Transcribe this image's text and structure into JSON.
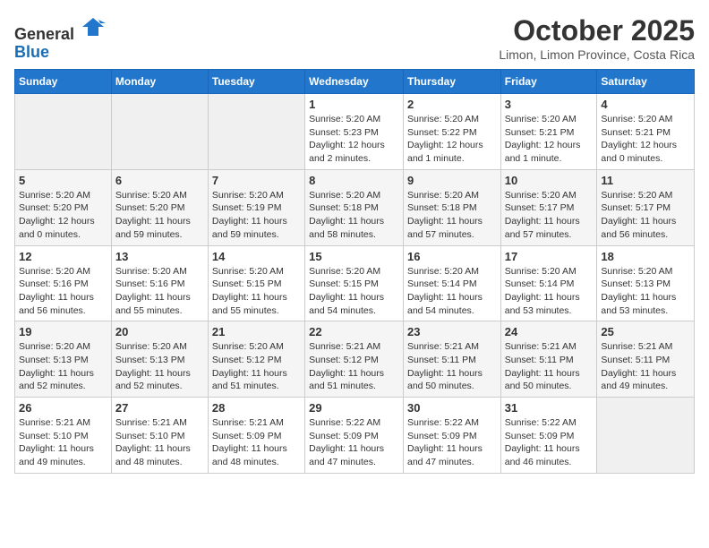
{
  "logo": {
    "general": "General",
    "blue": "Blue"
  },
  "title": "October 2025",
  "location": "Limon, Limon Province, Costa Rica",
  "headers": [
    "Sunday",
    "Monday",
    "Tuesday",
    "Wednesday",
    "Thursday",
    "Friday",
    "Saturday"
  ],
  "weeks": [
    [
      {
        "day": "",
        "info": ""
      },
      {
        "day": "",
        "info": ""
      },
      {
        "day": "",
        "info": ""
      },
      {
        "day": "1",
        "info": "Sunrise: 5:20 AM\nSunset: 5:23 PM\nDaylight: 12 hours and 2 minutes."
      },
      {
        "day": "2",
        "info": "Sunrise: 5:20 AM\nSunset: 5:22 PM\nDaylight: 12 hours and 1 minute."
      },
      {
        "day": "3",
        "info": "Sunrise: 5:20 AM\nSunset: 5:21 PM\nDaylight: 12 hours and 1 minute."
      },
      {
        "day": "4",
        "info": "Sunrise: 5:20 AM\nSunset: 5:21 PM\nDaylight: 12 hours and 0 minutes."
      }
    ],
    [
      {
        "day": "5",
        "info": "Sunrise: 5:20 AM\nSunset: 5:20 PM\nDaylight: 12 hours and 0 minutes."
      },
      {
        "day": "6",
        "info": "Sunrise: 5:20 AM\nSunset: 5:20 PM\nDaylight: 11 hours and 59 minutes."
      },
      {
        "day": "7",
        "info": "Sunrise: 5:20 AM\nSunset: 5:19 PM\nDaylight: 11 hours and 59 minutes."
      },
      {
        "day": "8",
        "info": "Sunrise: 5:20 AM\nSunset: 5:18 PM\nDaylight: 11 hours and 58 minutes."
      },
      {
        "day": "9",
        "info": "Sunrise: 5:20 AM\nSunset: 5:18 PM\nDaylight: 11 hours and 57 minutes."
      },
      {
        "day": "10",
        "info": "Sunrise: 5:20 AM\nSunset: 5:17 PM\nDaylight: 11 hours and 57 minutes."
      },
      {
        "day": "11",
        "info": "Sunrise: 5:20 AM\nSunset: 5:17 PM\nDaylight: 11 hours and 56 minutes."
      }
    ],
    [
      {
        "day": "12",
        "info": "Sunrise: 5:20 AM\nSunset: 5:16 PM\nDaylight: 11 hours and 56 minutes."
      },
      {
        "day": "13",
        "info": "Sunrise: 5:20 AM\nSunset: 5:16 PM\nDaylight: 11 hours and 55 minutes."
      },
      {
        "day": "14",
        "info": "Sunrise: 5:20 AM\nSunset: 5:15 PM\nDaylight: 11 hours and 55 minutes."
      },
      {
        "day": "15",
        "info": "Sunrise: 5:20 AM\nSunset: 5:15 PM\nDaylight: 11 hours and 54 minutes."
      },
      {
        "day": "16",
        "info": "Sunrise: 5:20 AM\nSunset: 5:14 PM\nDaylight: 11 hours and 54 minutes."
      },
      {
        "day": "17",
        "info": "Sunrise: 5:20 AM\nSunset: 5:14 PM\nDaylight: 11 hours and 53 minutes."
      },
      {
        "day": "18",
        "info": "Sunrise: 5:20 AM\nSunset: 5:13 PM\nDaylight: 11 hours and 53 minutes."
      }
    ],
    [
      {
        "day": "19",
        "info": "Sunrise: 5:20 AM\nSunset: 5:13 PM\nDaylight: 11 hours and 52 minutes."
      },
      {
        "day": "20",
        "info": "Sunrise: 5:20 AM\nSunset: 5:13 PM\nDaylight: 11 hours and 52 minutes."
      },
      {
        "day": "21",
        "info": "Sunrise: 5:20 AM\nSunset: 5:12 PM\nDaylight: 11 hours and 51 minutes."
      },
      {
        "day": "22",
        "info": "Sunrise: 5:21 AM\nSunset: 5:12 PM\nDaylight: 11 hours and 51 minutes."
      },
      {
        "day": "23",
        "info": "Sunrise: 5:21 AM\nSunset: 5:11 PM\nDaylight: 11 hours and 50 minutes."
      },
      {
        "day": "24",
        "info": "Sunrise: 5:21 AM\nSunset: 5:11 PM\nDaylight: 11 hours and 50 minutes."
      },
      {
        "day": "25",
        "info": "Sunrise: 5:21 AM\nSunset: 5:11 PM\nDaylight: 11 hours and 49 minutes."
      }
    ],
    [
      {
        "day": "26",
        "info": "Sunrise: 5:21 AM\nSunset: 5:10 PM\nDaylight: 11 hours and 49 minutes."
      },
      {
        "day": "27",
        "info": "Sunrise: 5:21 AM\nSunset: 5:10 PM\nDaylight: 11 hours and 48 minutes."
      },
      {
        "day": "28",
        "info": "Sunrise: 5:21 AM\nSunset: 5:09 PM\nDaylight: 11 hours and 48 minutes."
      },
      {
        "day": "29",
        "info": "Sunrise: 5:22 AM\nSunset: 5:09 PM\nDaylight: 11 hours and 47 minutes."
      },
      {
        "day": "30",
        "info": "Sunrise: 5:22 AM\nSunset: 5:09 PM\nDaylight: 11 hours and 47 minutes."
      },
      {
        "day": "31",
        "info": "Sunrise: 5:22 AM\nSunset: 5:09 PM\nDaylight: 11 hours and 46 minutes."
      },
      {
        "day": "",
        "info": ""
      }
    ]
  ]
}
